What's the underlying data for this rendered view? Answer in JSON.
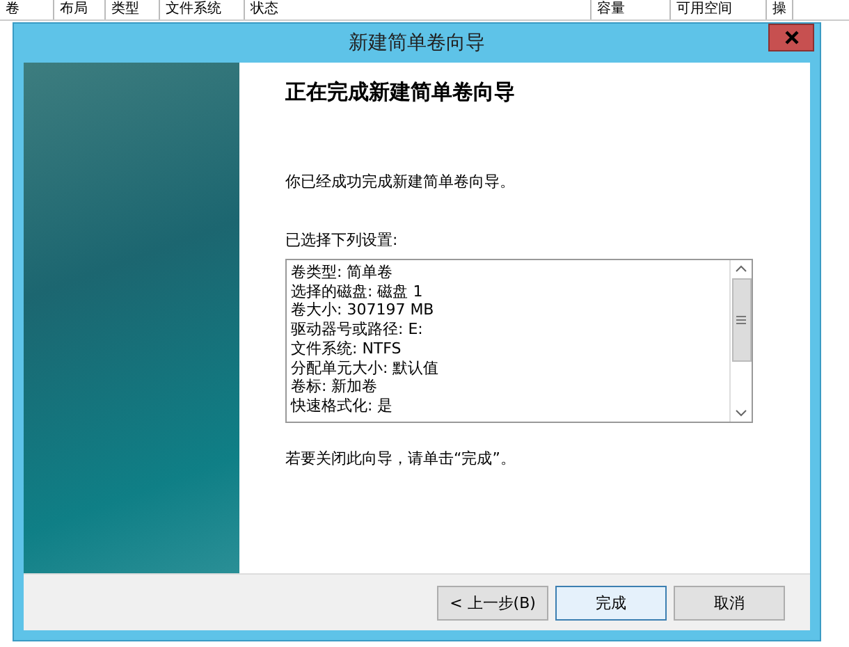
{
  "background_window": {
    "columns": [
      "卷",
      "布局",
      "类型",
      "文件系统",
      "状态",
      "容量",
      "可用空间",
      "操"
    ]
  },
  "dialog": {
    "title": "新建简单卷向导",
    "heading": "正在完成新建简单卷向导",
    "message": "你已经成功完成新建简单卷向导。",
    "settings_label": "已选择下列设置:",
    "settings": [
      "卷类型: 简单卷",
      "选择的磁盘: 磁盘 1",
      "卷大小: 307197 MB",
      "驱动器号或路径: E:",
      "文件系统: NTFS",
      "分配单元大小: 默认值",
      "卷标: 新加卷",
      "快速格式化: 是"
    ],
    "hint": "若要关闭此向导，请单击“完成”。",
    "buttons": [
      {
        "label": "< 上一步(B)",
        "kind": "normal"
      },
      {
        "label": "完成",
        "kind": "default"
      },
      {
        "label": "取消",
        "kind": "normal"
      }
    ]
  }
}
